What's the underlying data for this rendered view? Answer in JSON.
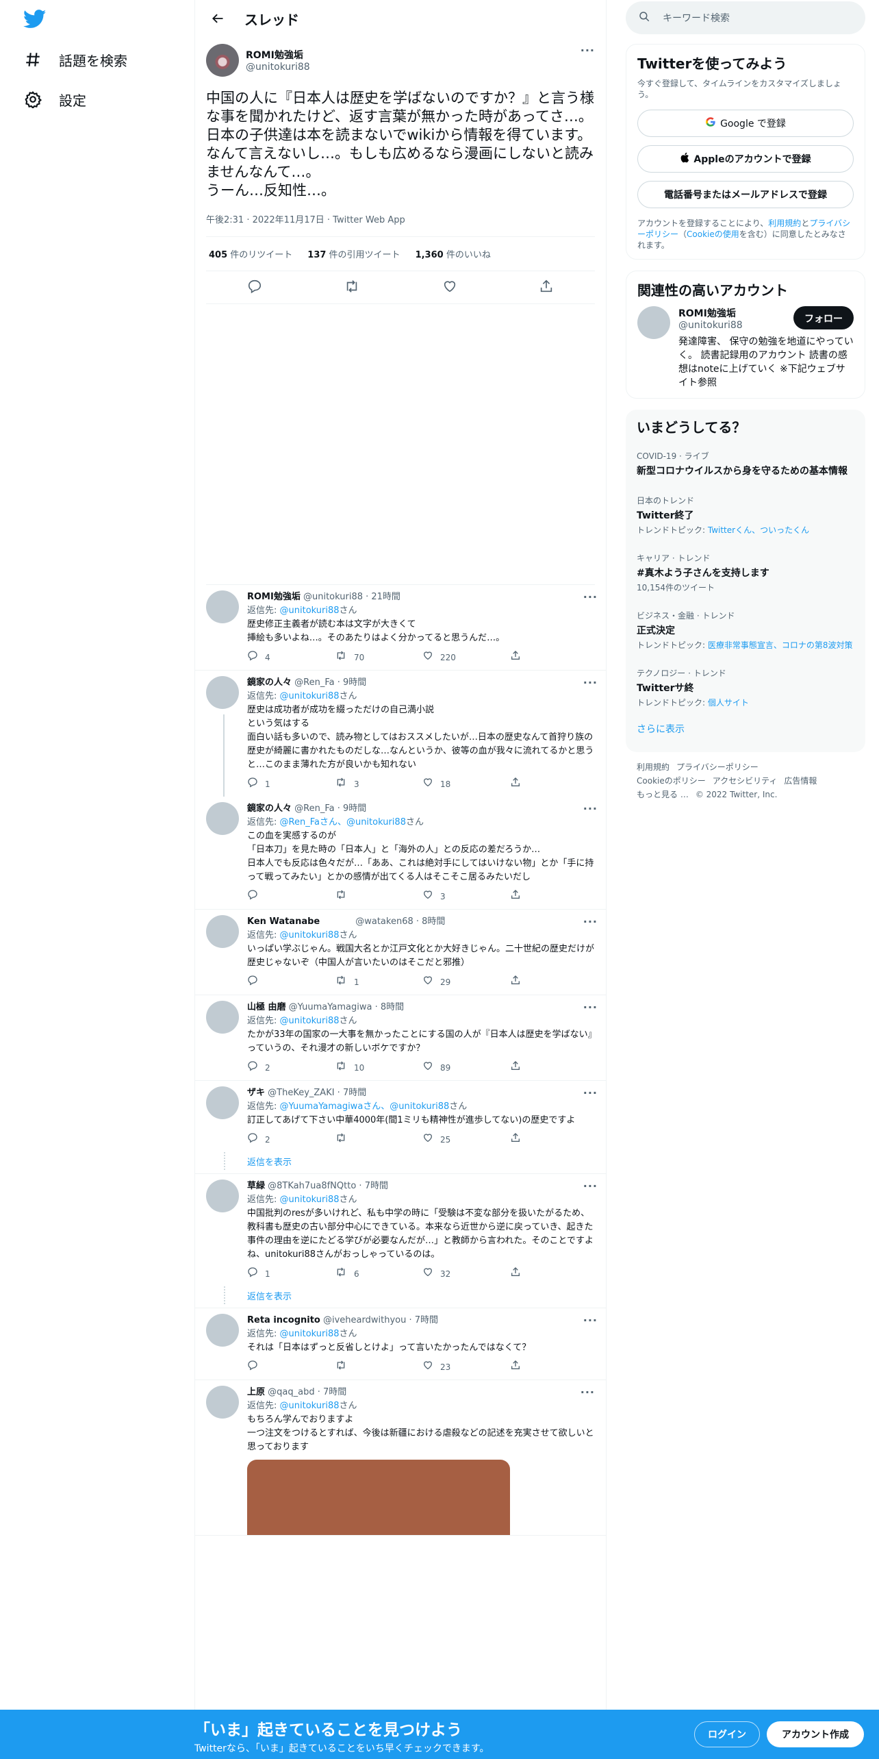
{
  "nav": {
    "explore": "話題を検索",
    "settings": "設定"
  },
  "header": {
    "title": "スレッド"
  },
  "main_post": {
    "name": "ROMI勉強垢",
    "handle": "@unitokuri88",
    "text": "中国の人に『日本人は歴史を学ばないのですか？』と言う様な事を聞かれたけど、返す言葉が無かった時があってさ…。\n日本の子供達は本を読まないでwikiから情報を得ています。なんて言えないし…。もしも広めるなら漫画にしないと読みませんなんて…。\nうーん…反知性…。",
    "meta": "午後2:31 · 2022年11月17日 · Twitter Web App",
    "retweets_num": "405",
    "retweets_label": " 件のリツイート",
    "quotes_num": "137",
    "quotes_label": " 件の引用ツイート",
    "likes_num": "1,360",
    "likes_label": " 件のいいね"
  },
  "replies": [
    {
      "name": "ROMI勉強垢",
      "meta": " @unitokuri88 · 21時間",
      "to_prefix": "返信先: ",
      "to": "@unitokuri88",
      "to_suffix": "さん",
      "body": "歴史修正主義者が読む本は文字が大きくて\n挿絵も多いよね…。そのあたりはよく分かってると思うんだ…。",
      "replies": "4",
      "retweets": "70",
      "likes": "220"
    },
    {
      "name": "鏡家の人々",
      "meta": " @Ren_Fa · 9時間",
      "to_prefix": "返信先: ",
      "to": "@unitokuri88",
      "to_suffix": "さん",
      "body": "歴史は成功者が成功を綴っただけの自己満小説\nという気はする\n面白い話も多いので、読み物としてはおススメしたいが…日本の歴史なんて首狩り族の歴史が綺麗に書かれたものだしな…なんというか、彼等の血が我々に流れてるかと思うと…このまま薄れた方が良いかも知れない",
      "replies": "1",
      "retweets": "3",
      "likes": "18"
    },
    {
      "name": "鏡家の人々",
      "meta": " @Ren_Fa · 9時間",
      "to_prefix": "返信先: ",
      "to": "@Ren_Faさん、@unitokuri88",
      "to_suffix": "さん",
      "body": "この血を実感するのが\n「日本刀」を見た時の「日本人」と「海外の人」との反応の差だろうか…\n日本人でも反応は色々だが…「ああ、これは絶対手にしてはいけない物」とか「手に持って戦ってみたい」とかの感情が出てくる人はそこそこ居るみたいだし",
      "replies": "",
      "retweets": "",
      "likes": "3"
    },
    {
      "name": "Ken Watanabe",
      "meta": "　　　　@wataken68 · 8時間",
      "to_prefix": "返信先: ",
      "to": "@unitokuri88",
      "to_suffix": "さん",
      "body": "いっぱい学ぶじゃん。戦国大名とか江戸文化とか大好きじゃん。二十世紀の歴史だけが歴史じゃないぞ（中国人が言いたいのはそこだと邪推）",
      "replies": "",
      "retweets": "1",
      "likes": "29"
    },
    {
      "name": "山極 由磨",
      "meta": " @YuumaYamagiwa · 8時間",
      "to_prefix": "返信先: ",
      "to": "@unitokuri88",
      "to_suffix": "さん",
      "body": "たかが33年の国家の一大事を無かったことにする国の人が『日本人は歴史を学ばない』っていうの、それ漫才の新しいボケですか？",
      "replies": "2",
      "retweets": "10",
      "likes": "89"
    },
    {
      "name": "ザキ",
      "meta": " @TheKey_ZAKI · 7時間",
      "to_prefix": "返信先: ",
      "to": "@YuumaYamagiwaさん、@unitokuri88",
      "to_suffix": "さん",
      "body": "訂正してあげて下さい中華4000年(間1ミリも精神性が進歩してない)の歴史ですよ",
      "replies": "2",
      "retweets": "",
      "likes": "25"
    },
    {
      "name": "草緑",
      "meta": " @8TKah7ua8fNQtto · 7時間",
      "to_prefix": "返信先: ",
      "to": "@unitokuri88",
      "to_suffix": "さん",
      "body": "中国批判のresが多いけれど、私も中学の時に「受験は不変な部分を扱いたがるため、教科書も歴史の古い部分中心にできている。本来なら近世から逆に戻っていき、起きた事件の理由を逆にたどる学びが必要なんだが…」と教師から言われた。そのことですよね、unitokuri88さんがおっしゃっているのは。",
      "replies": "1",
      "retweets": "6",
      "likes": "32"
    },
    {
      "name": "Reta incognito",
      "meta": " @iveheardwithyou · 7時間",
      "to_prefix": "返信先: ",
      "to": "@unitokuri88",
      "to_suffix": "さん",
      "body": "それは「日本はずっと反省しとけよ」って言いたかったんではなくて？",
      "replies": "",
      "retweets": "",
      "likes": "23"
    },
    {
      "name": "上原",
      "meta": " @qaq_abd · 7時間",
      "to_prefix": "返信先: ",
      "to": "@unitokuri88",
      "to_suffix": "さん",
      "body": "もちろん学んでおりますよ\n一つ注文をつけるとすれば、今後は新疆における虐殺などの記述を充実させて欲しいと思っております"
    }
  ],
  "show_replies": "返信を表示",
  "right": {
    "search_placeholder": "キーワード検索",
    "signup_card": {
      "title": "Twitterを使ってみよう",
      "sub": "今すぐ登録して、タイムラインをカスタマイズしましょう。",
      "google": "Google で登録",
      "apple": "Appleのアカウントで登録",
      "phone": "電話番号またはメールアドレスで登録",
      "legal_1": "アカウントを登録することにより、",
      "legal_link1": "利用規約",
      "legal_2": "と",
      "legal_link2": "プライバシーポリシー",
      "legal_3": "（",
      "legal_link3": "Cookieの使用",
      "legal_4": "を含む）に同意したとみなされます。"
    },
    "related": {
      "title": "関連性の高いアカウント",
      "name": "ROMI勉強垢",
      "handle": "@unitokuri88",
      "follow": "フォロー",
      "bio": "発達障害、 保守の勉強を地道にやっていく。 読書記録用のアカウント 読書の感想はnoteに上げていく ※下記ウェブサイト参照"
    },
    "trends": {
      "title": "いまどうしてる？",
      "items": [
        {
          "cat": "COVID-19 · ライブ",
          "title": "新型コロナウイルスから身を守るための基本情報",
          "extra_label": "",
          "extra": ""
        },
        {
          "cat": "日本のトレンド",
          "title": "Twitter終了",
          "extra_label": "トレンドトピック: ",
          "extra": "Twitterくん、ついったくん"
        },
        {
          "cat": "キャリア · トレンド",
          "title": "#真木よう子さんを支持します",
          "extra_label": "10,154件のツイート",
          "extra": ""
        },
        {
          "cat": "ビジネス・金融 · トレンド",
          "title": "正式決定",
          "extra_label": "トレンドトピック: ",
          "extra": "医療非常事態宣言、コロナの第8波対策"
        },
        {
          "cat": "テクノロジー · トレンド",
          "title": "Twitterサ終",
          "extra_label": "トレンドトピック: ",
          "extra": "個人サイト"
        }
      ],
      "show_more": "さらに表示"
    },
    "footer": {
      "l1": "利用規約",
      "l2": "プライバシーポリシー",
      "l3": "Cookieのポリシー",
      "l4": "アクセシビリティ",
      "l5": "広告情報",
      "l6": "もっと見る …",
      "l7": "© 2022 Twitter, Inc."
    }
  },
  "bottom": {
    "title": "「いま」起きていることを見つけよう",
    "sub": "Twitterなら、「いま」起きていることをいち早くチェックできます。",
    "login": "ログイン",
    "signup": "アカウント作成"
  },
  "colors": {
    "accent": "#1d9bf0",
    "text": "#0f1419",
    "muted": "#536471"
  }
}
